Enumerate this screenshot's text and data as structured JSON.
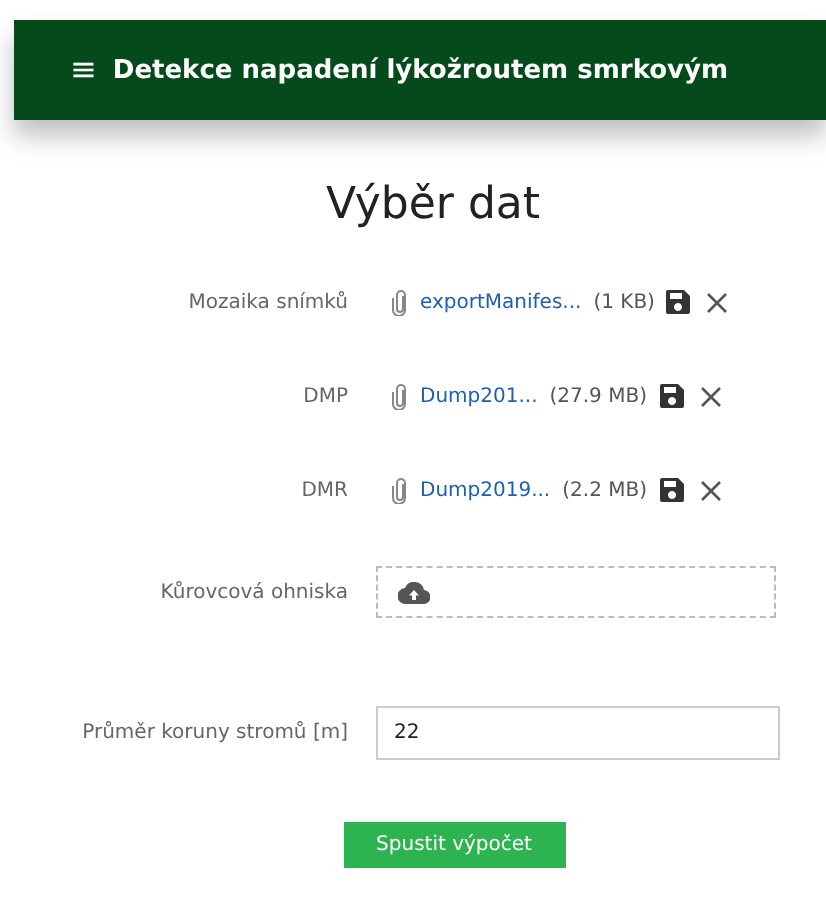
{
  "app_bar": {
    "menu_glyph": "≡",
    "title": "Detekce napadení lýkožroutem smrkovým"
  },
  "heading": "Výběr dat",
  "fields": [
    {
      "kind": "file",
      "label": "Mozaika snímků",
      "file_name": "exportManifes...",
      "size": "(1 KB)"
    },
    {
      "kind": "file",
      "label": "DMP",
      "file_name": "Dump201...",
      "size": "(27.9 MB)"
    },
    {
      "kind": "file",
      "label": "DMR",
      "file_name": "Dump2019...",
      "size": "(2.2 MB)"
    },
    {
      "kind": "dropzone",
      "label": "Kůrovcová ohniska"
    },
    {
      "kind": "number",
      "label": "Průměr koruny stromů [m]",
      "value": "22"
    }
  ],
  "submit_button": "Spustit výpočet"
}
